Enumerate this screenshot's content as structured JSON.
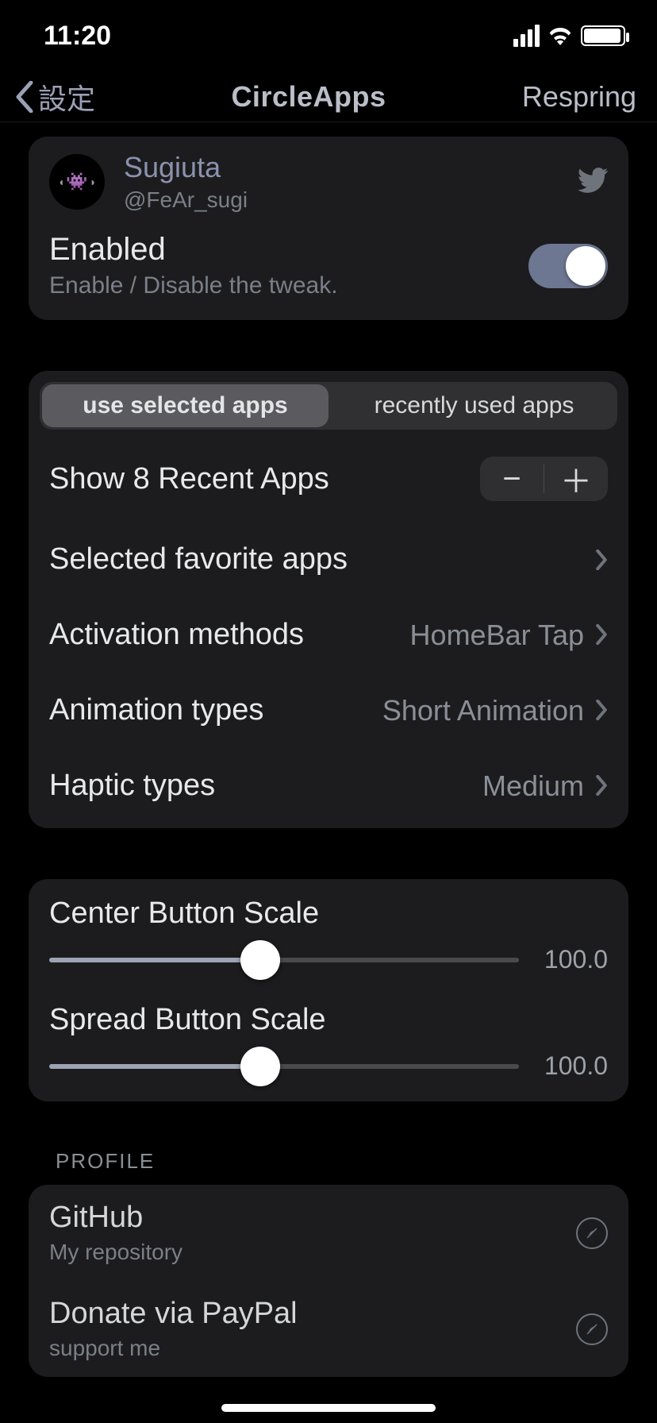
{
  "status": {
    "time": "11:20"
  },
  "nav": {
    "back": "設定",
    "title": "CircleApps",
    "right": "Respring"
  },
  "author": {
    "name": "Sugiuta",
    "handle": "@FeAr_sugi"
  },
  "enabled": {
    "title": "Enabled",
    "subtitle": "Enable / Disable the tweak.",
    "on": true
  },
  "segmented": {
    "a": "use selected apps",
    "b": "recently used apps"
  },
  "rows": {
    "recent": {
      "label": "Show 8 Recent Apps"
    },
    "favorite": {
      "label": "Selected favorite apps"
    },
    "activation": {
      "label": "Activation methods",
      "value": "HomeBar Tap"
    },
    "animation": {
      "label": "Animation types",
      "value": "Short Animation"
    },
    "haptic": {
      "label": "Haptic types",
      "value": "Medium"
    }
  },
  "sliders": {
    "center": {
      "label": "Center Button Scale",
      "value": "100.0"
    },
    "spread": {
      "label": "Spread Button Scale",
      "value": "100.0"
    }
  },
  "profile": {
    "header": "PROFILE",
    "github": {
      "title": "GitHub",
      "sub": "My repository"
    },
    "donate": {
      "title": "Donate via PayPal",
      "sub": "support me"
    }
  }
}
